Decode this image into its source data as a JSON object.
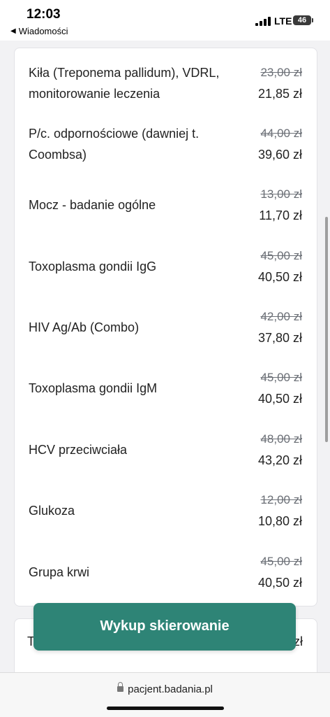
{
  "status": {
    "time": "12:03",
    "back_label": "Wiadomości",
    "network": "LTE",
    "battery": "46"
  },
  "items": [
    {
      "name": "Kiła (Treponema pallidum), VDRL, monitorowanie leczenia",
      "old_price": "23,00 zł",
      "new_price": "21,85 zł"
    },
    {
      "name": "P/c. odpornościowe (dawniej t. Coombsa)",
      "old_price": "44,00 zł",
      "new_price": "39,60 zł"
    },
    {
      "name": "Mocz - badanie ogólne",
      "old_price": "13,00 zł",
      "new_price": "11,70 zł"
    },
    {
      "name": "Toxoplasma gondii IgG",
      "old_price": "45,00 zł",
      "new_price": "40,50 zł"
    },
    {
      "name": "HIV Ag/Ab (Combo)",
      "old_price": "42,00 zł",
      "new_price": "37,80 zł"
    },
    {
      "name": "Toxoplasma gondii IgM",
      "old_price": "45,00 zł",
      "new_price": "40,50 zł"
    },
    {
      "name": "HCV przeciwciała",
      "old_price": "48,00 zł",
      "new_price": "43,20 zł"
    },
    {
      "name": "Glukoza",
      "old_price": "12,00 zł",
      "new_price": "10,80 zł"
    },
    {
      "name": "Grupa krwi",
      "old_price": "45,00 zł",
      "new_price": "40,50 zł"
    }
  ],
  "peek": {
    "left": "T",
    "right": "zł"
  },
  "cta": {
    "label": "Wykup skierowanie"
  },
  "browser": {
    "url": "pacjent.badania.pl"
  },
  "colors": {
    "accent": "#2e8476"
  }
}
